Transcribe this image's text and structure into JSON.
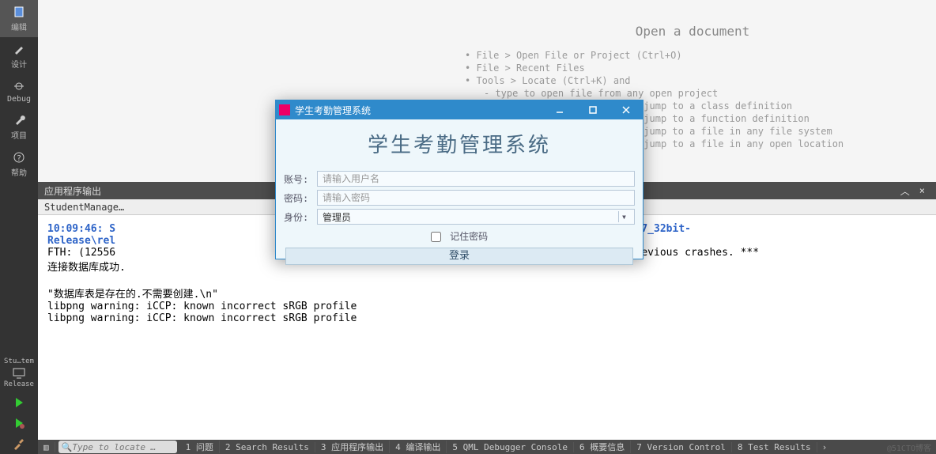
{
  "leftRail": {
    "items": [
      {
        "icon": "edit",
        "label": "编辑"
      },
      {
        "icon": "brush",
        "label": "设计"
      },
      {
        "icon": "bug",
        "label": "Debug"
      },
      {
        "icon": "wrench",
        "label": "项目"
      },
      {
        "icon": "help",
        "label": "帮助"
      }
    ],
    "kit": {
      "top": "Stu…tem",
      "mid": "",
      "bot": "Release"
    },
    "run": "run",
    "debug": "debug",
    "build": "build"
  },
  "editor": {
    "open_title": "Open a document",
    "hints": [
      "File > Open File or Project (Ctrl+O)",
      "File > Recent Files",
      "Tools > Locate (Ctrl+K) and"
    ],
    "subhints": [
      "type to open file from any open project",
      "type c<space><pattern> to jump to a class definition",
      "type p<space><pattern> to jump to a function definition",
      "type f<space><pattern> to jump to a file in any file system",
      "type l<space><pattern> to jump to a file in any open location"
    ]
  },
  "output": {
    "header": "应用程序输出",
    "tab": "StudentManage…",
    "ts_line": "10:09:46: S                                                                top_Qt_5_12_6_MSVC2017_32bit-",
    "rel_line": "Release\\rel",
    "fth_line": "FTH: (12556                                                                 is usually due to previous crashes. ***",
    "db_ok": "连接数据库成功.",
    "exist_line": "\"数据库表是存在的.不需要创建.\\n\"",
    "png1": "libpng warning: iCCP: known incorrect sRGB profile",
    "png2": "libpng warning: iCCP: known incorrect sRGB profile"
  },
  "dialog": {
    "title": "学生考勤管理系统",
    "heading": "学生考勤管理系统",
    "user_label": "账号:",
    "user_ph": "请输入用户名",
    "pass_label": "密码:",
    "pass_ph": "请输入密码",
    "role_label": "身份:",
    "role_value": "管理员",
    "remember": "记住密码",
    "login": "登录"
  },
  "status": {
    "search_ph": "Type to locate …",
    "items": [
      "1 问题",
      "2 Search Results",
      "3 应用程序输出",
      "4 编译输出",
      "5 QML Debugger Console",
      "6 概要信息",
      "7 Version Control",
      "8 Test Results"
    ],
    "watermark": "@51CTO博客"
  }
}
